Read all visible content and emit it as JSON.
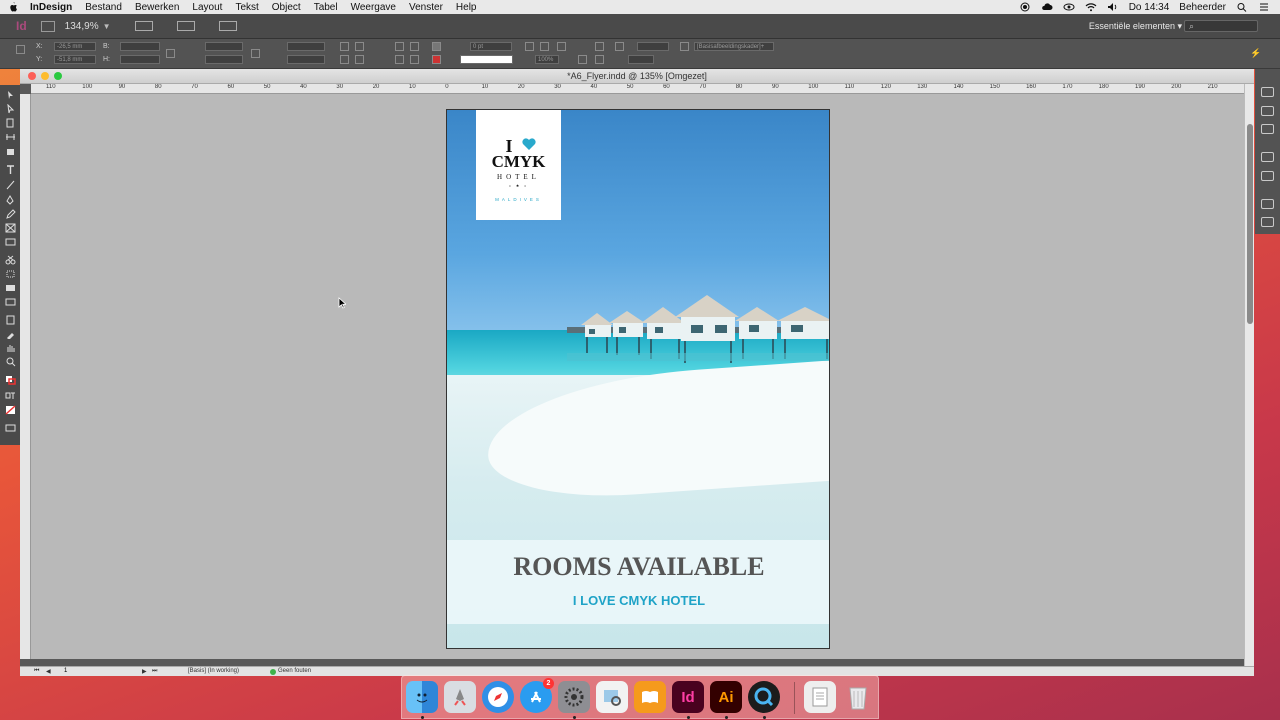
{
  "menubar": {
    "app_name": "InDesign",
    "items": [
      "Bestand",
      "Bewerken",
      "Layout",
      "Tekst",
      "Object",
      "Tabel",
      "Weergave",
      "Venster",
      "Help"
    ],
    "clock": "Do 14:34",
    "user": "Beheerder"
  },
  "appbar": {
    "logo": "Id",
    "zoom": "134,9%",
    "workspace": "Essentiële elementen",
    "search_placeholder": "⌕"
  },
  "control": {
    "x_label": "X:",
    "y_label": "Y:",
    "w_label": "B:",
    "h_label": "H:",
    "x_value": "-26,5 mm",
    "y_value": "-51,8 mm",
    "stroke_weight": "0 pt",
    "opacity": "100%",
    "object_style": "[Basisafbeeldingskader]+"
  },
  "document": {
    "title": "*A6_Flyer.indd @ 135% [Omgezet]",
    "ruler_ticks": [
      "110",
      "100",
      "90",
      "80",
      "70",
      "60",
      "50",
      "40",
      "30",
      "20",
      "10",
      "0",
      "10",
      "20",
      "30",
      "40",
      "50",
      "60",
      "70",
      "80",
      "90",
      "100",
      "110",
      "120",
      "130",
      "140",
      "150",
      "160",
      "170",
      "180",
      "190",
      "200",
      "210"
    ],
    "status": {
      "page": "1",
      "profile": "[Basis] (In working)",
      "preflight": "Geen fouten"
    }
  },
  "flyer": {
    "brand_i": "I",
    "brand_name": "CMYK",
    "brand_hotel": "HOTEL",
    "brand_stars": "• ★ •",
    "brand_sub": "MALDIVES",
    "headline": "ROOMS AVAILABLE",
    "subline": "I LOVE CMYK HOTEL"
  },
  "dock": {
    "indesign_label": "Id",
    "illustrator_label": "Ai",
    "appstore_badge": "2"
  },
  "colors": {
    "brand_teal": "#1fa3c7",
    "indesign_pink": "#ff3ea5",
    "illustrator_orange": "#ff9a00"
  }
}
